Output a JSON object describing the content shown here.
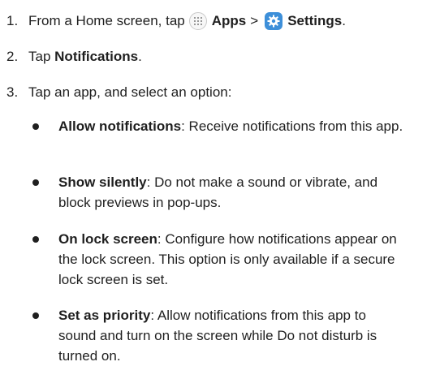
{
  "steps": [
    {
      "number": "1.",
      "text_before": "From a Home screen, tap",
      "apps_label": "Apps",
      "separator": ">",
      "settings_label": "Settings",
      "text_after": "."
    },
    {
      "number": "2.",
      "text_before": "Tap",
      "bold": "Notifications",
      "text_after": "."
    },
    {
      "number": "3.",
      "text": "Tap an app, and select an option:"
    }
  ],
  "options": [
    {
      "term": "Allow notifications",
      "description": ": Receive notifications from this app."
    },
    {
      "term": "Show silently",
      "description": ": Do not make a sound or vibrate, and block previews in pop-ups."
    },
    {
      "term": "On lock screen",
      "description": ": Configure how notifications appear on the lock screen. This option is only available if a secure lock screen is set."
    },
    {
      "term": "Set as priority",
      "description": ": Allow notifications from this app to sound and turn on the screen while Do not disturb is turned on."
    }
  ],
  "icons": {
    "apps": "apps-grid-icon",
    "settings": "settings-gear-icon",
    "settings_color": "#3d8fd9"
  }
}
